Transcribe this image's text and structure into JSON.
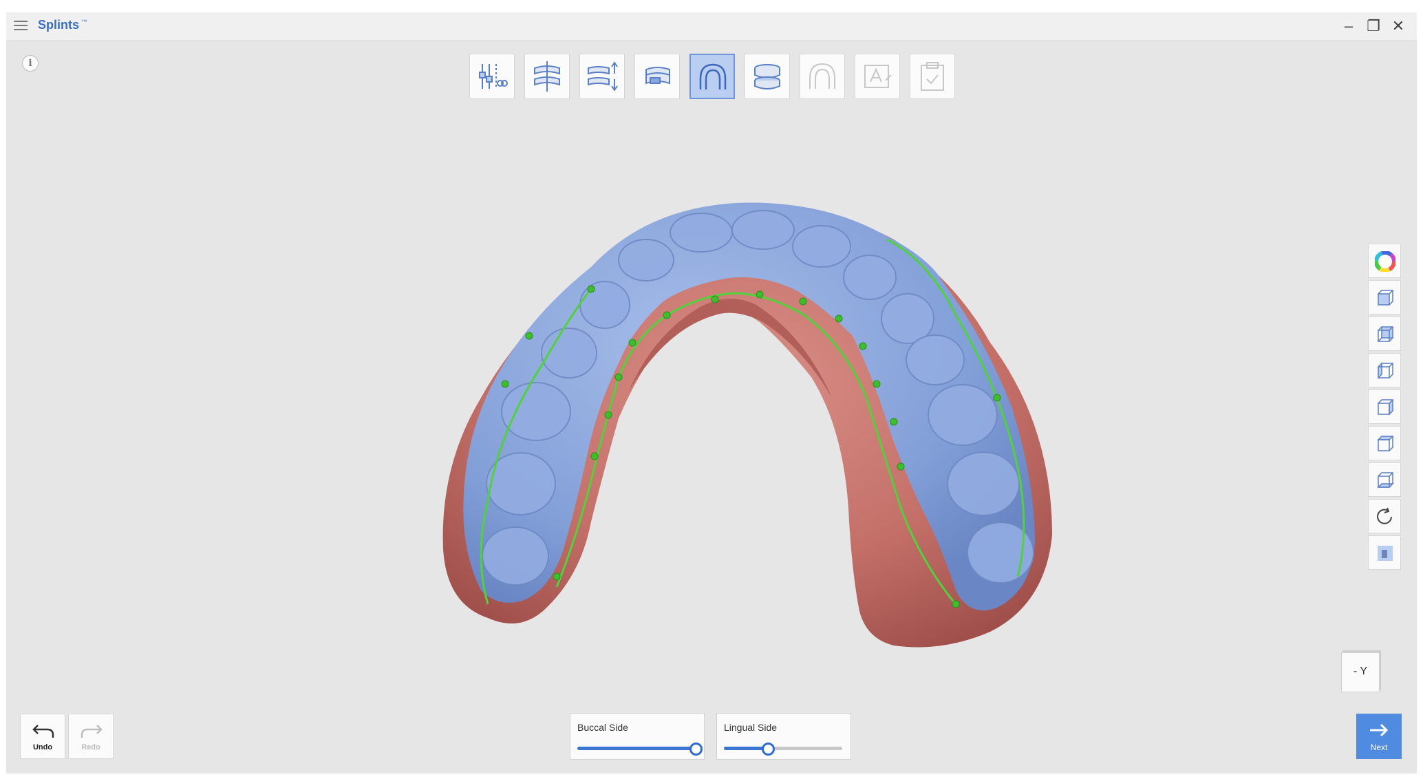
{
  "app": {
    "title": "Splints",
    "title_badge": "™",
    "window_controls": {
      "minimize": "–",
      "maximize": "❐",
      "close": "✕"
    },
    "info_icon": "i"
  },
  "toolbar": {
    "steps": [
      {
        "icon": "trim-adjust-icon",
        "state": "normal"
      },
      {
        "icon": "align-occlusion-icon",
        "state": "normal"
      },
      {
        "icon": "insertion-direction-icon",
        "state": "normal"
      },
      {
        "icon": "undercut-block-icon",
        "state": "normal"
      },
      {
        "icon": "margin-line-icon",
        "state": "active"
      },
      {
        "icon": "thickness-layers-icon",
        "state": "normal"
      },
      {
        "icon": "splint-shape-icon",
        "state": "disabled"
      },
      {
        "icon": "text-label-icon",
        "state": "disabled"
      },
      {
        "icon": "finish-check-icon",
        "state": "disabled"
      }
    ]
  },
  "view_tools": [
    "color-wheel-icon",
    "front-view-icon",
    "back-view-icon",
    "left-view-icon",
    "right-view-icon",
    "top-view-icon",
    "bottom-view-icon",
    "reset-rotation-icon",
    "model-visibility-icon"
  ],
  "axis_cube": {
    "label": "- Y"
  },
  "bottom": {
    "undo_label": "Undo",
    "redo_label": "Redo",
    "buccal": {
      "label": "Buccal Side",
      "value": 1.0
    },
    "lingual": {
      "label": "Lingual Side",
      "value": 0.37
    },
    "next_label": "Next"
  },
  "colors": {
    "accent": "#4f8be0",
    "tooth": "#8aa6dd",
    "gingiva": "#c9766f",
    "margin_line": "#4fd23a"
  }
}
